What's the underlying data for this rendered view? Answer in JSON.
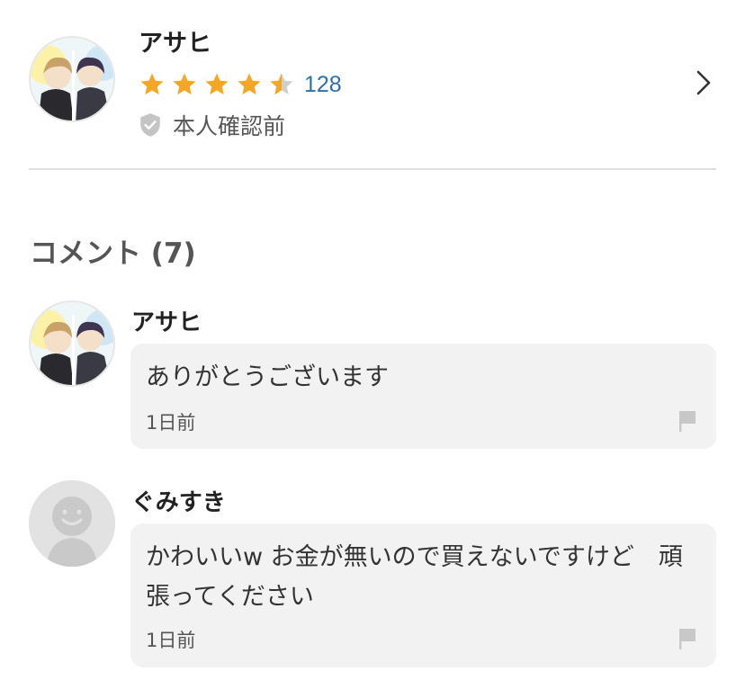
{
  "seller": {
    "name": "アサヒ",
    "rating": 4.5,
    "rating_count": "128",
    "verification": "本人確認前"
  },
  "comments_section": {
    "title": "コメント (7)"
  },
  "comments": [
    {
      "name": "アサヒ",
      "text": "ありがとうございます",
      "time": "1日前",
      "avatar": "user-illustration"
    },
    {
      "name": "ぐみすき",
      "text": "かわいいw お金が無いので買えないですけど　頑張ってください",
      "time": "1日前",
      "avatar": "default-avatar"
    }
  ],
  "colors": {
    "star": "#f5a623",
    "star_empty": "#cfcfcf",
    "link": "#2f6fa8",
    "bubble": "#f2f2f2"
  }
}
